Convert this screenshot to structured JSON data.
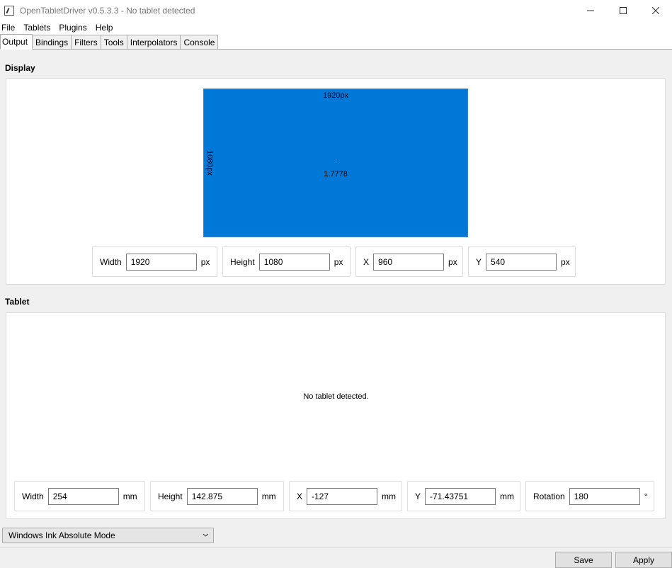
{
  "window": {
    "title": "OpenTabletDriver v0.5.3.3 - No tablet detected",
    "icon": "app-icon",
    "controls": [
      "minimize-icon",
      "maximize-icon",
      "close-icon"
    ]
  },
  "menu": {
    "items": [
      {
        "label": "File"
      },
      {
        "label": "Tablets"
      },
      {
        "label": "Plugins"
      },
      {
        "label": "Help"
      }
    ]
  },
  "tabs": {
    "items": [
      {
        "label": "Output",
        "active": true
      },
      {
        "label": "Bindings"
      },
      {
        "label": "Filters"
      },
      {
        "label": "Tools"
      },
      {
        "label": "Interpolators"
      },
      {
        "label": "Console"
      }
    ]
  },
  "display": {
    "section_label": "Display",
    "area": {
      "width_label": "1920px",
      "height_label": "1080px",
      "ratio_label": "1.7778",
      "color": "#0078d7"
    },
    "fields": {
      "width": {
        "label": "Width",
        "value": "1920",
        "unit": "px"
      },
      "height": {
        "label": "Height",
        "value": "1080",
        "unit": "px"
      },
      "x": {
        "label": "X",
        "value": "960",
        "unit": "px"
      },
      "y": {
        "label": "Y",
        "value": "540",
        "unit": "px"
      }
    }
  },
  "tablet": {
    "section_label": "Tablet",
    "status": "No tablet detected.",
    "fields": {
      "width": {
        "label": "Width",
        "value": "254",
        "unit": "mm"
      },
      "height": {
        "label": "Height",
        "value": "142.875",
        "unit": "mm"
      },
      "x": {
        "label": "X",
        "value": "-127",
        "unit": "mm"
      },
      "y": {
        "label": "Y",
        "value": "-71.43751",
        "unit": "mm"
      },
      "rotation": {
        "label": "Rotation",
        "value": "180",
        "unit": "°"
      }
    }
  },
  "output_mode": {
    "selected": "Windows Ink Absolute Mode",
    "icon": "chevron-down-icon"
  },
  "footer": {
    "save_label": "Save",
    "apply_label": "Apply"
  }
}
